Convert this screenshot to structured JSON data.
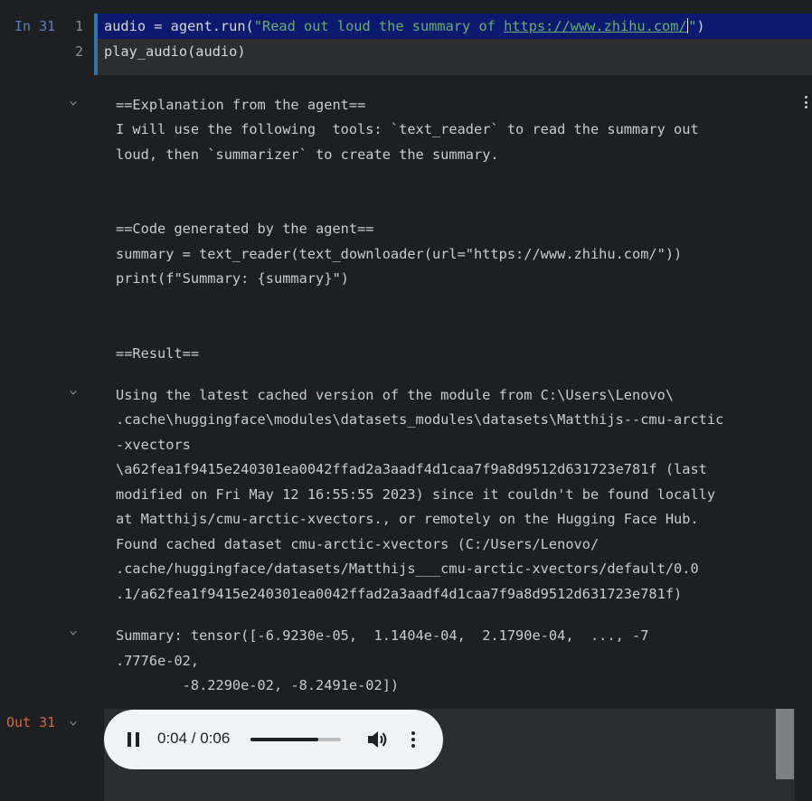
{
  "input_cell": {
    "exec_label": "In 31",
    "lines": [
      {
        "number": "1",
        "code_before": "audio = agent.run(",
        "string_before_url": "\"Read out loud the summary of ",
        "url": "https://www.zhihu.com/",
        "string_after_caret": "\"",
        "code_after": ")"
      },
      {
        "number": "2",
        "code": "play_audio(audio)"
      }
    ]
  },
  "output": {
    "lines_block1": [
      "==Explanation from the agent==",
      "I will use the following  tools: `text_reader` to read the summary out",
      "loud, then `summarizer` to create the summary.",
      "==Code generated by the agent==",
      "summary = text_reader(text_downloader(url=\"https://www.zhihu.com/\"))",
      "print(f\"Summary: {summary}\")",
      "==Result=="
    ],
    "lines_block2": [
      "Using the latest cached version of the module from C:\\Users\\Lenovo\\",
      ".cache\\huggingface\\modules\\datasets_modules\\datasets\\Matthijs--cmu-arctic",
      "-xvectors",
      "\\a62fea1f9415e240301ea0042ffad2a3aadf4d1caa7f9a8d9512d631723e781f (last",
      "modified on Fri May 12 16:55:55 2023) since it couldn't be found locally",
      "at Matthijs/cmu-arctic-xvectors., or remotely on the Hugging Face Hub.",
      "Found cached dataset cmu-arctic-xvectors (C:/Users/Lenovo/",
      ".cache/huggingface/datasets/Matthijs___cmu-arctic-xvectors/default/0.0",
      ".1/a62fea1f9415e240301ea0042ffad2a3aadf4d1caa7f9a8d9512d631723e781f)"
    ],
    "lines_block3": [
      "Summary: tensor([-6.9230e-05,  1.1404e-04,  2.1790e-04,  ..., -7",
      ".7776e-02,",
      "        -8.2290e-02, -8.2491e-02])"
    ]
  },
  "output_cell": {
    "label": "Out 31",
    "audio_player": {
      "time": "0:04 / 0:06",
      "progress_fraction": 0.75,
      "pause_icon": "pause-icon",
      "volume_icon": "volume-icon",
      "menu_icon": "more-vert-icon"
    }
  },
  "icons": {
    "collapse": "chevron-down-icon",
    "cell_menu": "kebab-menu-icon"
  }
}
